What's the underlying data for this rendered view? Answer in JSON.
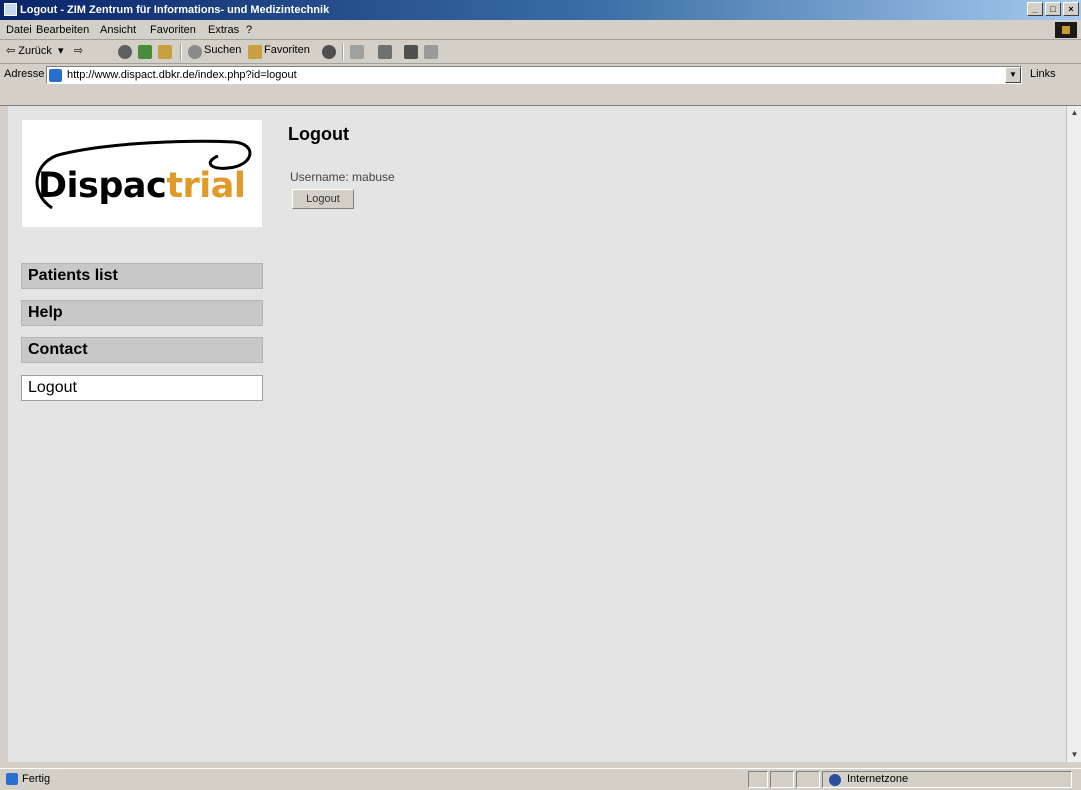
{
  "window": {
    "title": "Logout - ZIM Zentrum für Informations- und Medizintechnik",
    "buttons": [
      "_",
      "□",
      "×"
    ]
  },
  "menu": {
    "items": [
      "Datei",
      "Bearbeiten",
      "Ansicht",
      "Favoriten",
      "Extras",
      "?"
    ]
  },
  "toolbar": {
    "back_label": "⇦ Zurück",
    "forward_label": "⇨",
    "search_label": "Suchen",
    "favorites_label": "Favoriten"
  },
  "address": {
    "label": "Adresse",
    "url": "http://www.dispact.dbkr.de/index.php?id=logout",
    "links_label": "Links"
  },
  "logo": {
    "text_main": "Dispac",
    "text_accent": "trial"
  },
  "nav": {
    "items": [
      {
        "label": "Patients list"
      },
      {
        "label": "Help"
      },
      {
        "label": "Contact"
      },
      {
        "label": "Logout"
      }
    ]
  },
  "main": {
    "title": "Logout",
    "username_label": "Username:",
    "username_value": "mabuse",
    "logout_button": "Logout"
  },
  "status": {
    "text": "Fertig",
    "zone": "Internetzone"
  }
}
